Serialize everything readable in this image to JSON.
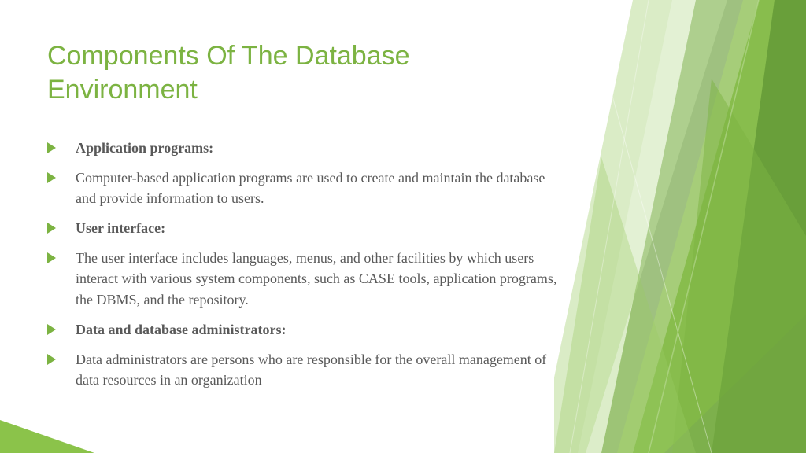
{
  "slide": {
    "title": "Components Of The Database Environment",
    "bullets": [
      {
        "text": "Application programs:",
        "bold": true
      },
      {
        "text": " Computer-based application programs are used to create and maintain the database and provide information to users.",
        "bold": false
      },
      {
        "text": "User interface:",
        "bold": true
      },
      {
        "text": "The user interface includes languages, menus, and other facilities by which users interact with various system components, such as CASE tools, application programs, the DBMS, and the repository.",
        "bold": false
      },
      {
        "text": "Data and database administrators:",
        "bold": true
      },
      {
        "text": "Data administrators are persons who are responsible for the overall management of data resources in an organization",
        "bold": false
      }
    ]
  },
  "theme": {
    "accent": "#7cb342",
    "text": "#595959"
  }
}
